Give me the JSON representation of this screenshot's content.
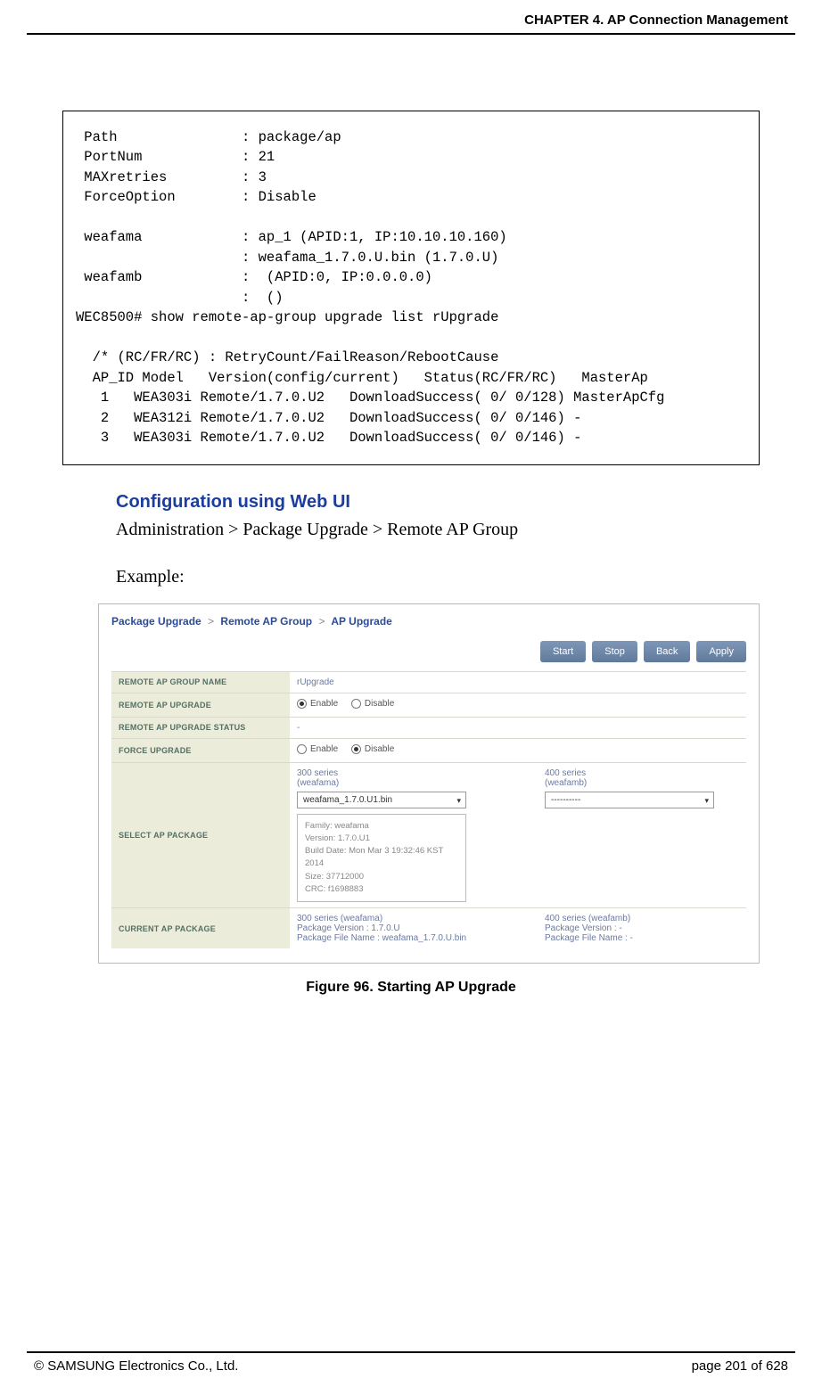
{
  "header": {
    "chapter": "CHAPTER 4. AP Connection Management"
  },
  "code_block": " Path               : package/ap\n PortNum            : 21\n MAXretries         : 3\n ForceOption        : Disable\n\n weafama            : ap_1 (APID:1, IP:10.10.10.160)\n                    : weafama_1.7.0.U.bin (1.7.0.U)\n weafamb            :  (APID:0, IP:0.0.0.0)\n                    :  ()\nWEC8500# show remote-ap-group upgrade list rUpgrade\n\n  /* (RC/FR/RC) : RetryCount/FailReason/RebootCause\n  AP_ID Model   Version(config/current)   Status(RC/FR/RC)   MasterAp\n   1   WEA303i Remote/1.7.0.U2   DownloadSuccess( 0/ 0/128) MasterApCfg\n   2   WEA312i Remote/1.7.0.U2   DownloadSuccess( 0/ 0/146) -\n   3   WEA303i Remote/1.7.0.U2   DownloadSuccess( 0/ 0/146) -",
  "section": {
    "heading": "Configuration using Web UI",
    "path_text": "Administration > Package Upgrade > Remote AP Group",
    "example_label": "Example:"
  },
  "ui": {
    "breadcrumb": [
      "Package Upgrade",
      "Remote AP Group",
      "AP Upgrade"
    ],
    "buttons": {
      "start": "Start",
      "stop": "Stop",
      "back": "Back",
      "apply": "Apply"
    },
    "rows": {
      "group_name": {
        "label": "REMOTE AP GROUP NAME",
        "value": "rUpgrade"
      },
      "upgrade": {
        "label": "REMOTE AP UPGRADE",
        "enable": "Enable",
        "disable": "Disable",
        "selected": "enable"
      },
      "status": {
        "label": "REMOTE AP UPGRADE STATUS",
        "value": "-"
      },
      "force": {
        "label": "FORCE UPGRADE",
        "enable": "Enable",
        "disable": "Disable",
        "selected": "disable"
      },
      "select_pkg": {
        "label": "SELECT AP PACKAGE",
        "col300_label": "300 series\n(weafama)",
        "col400_label": "400 series\n(weafamb)",
        "col300_select": "weafama_1.7.0.U1.bin",
        "col400_select": "----------",
        "details": "Family: weafama\nVersion: 1.7.0.U1\nBuild Date: Mon Mar 3 19:32:46 KST 2014\nSize: 37712000\nCRC: f1698883"
      },
      "current_pkg": {
        "label": "CURRENT AP PACKAGE",
        "col300": "300 series (weafama)\nPackage Version : 1.7.0.U\nPackage File Name : weafama_1.7.0.U.bin",
        "col400": "400 series (weafamb)\nPackage Version : -\nPackage File Name : -"
      }
    }
  },
  "figure_caption": "Figure 96. Starting AP Upgrade",
  "footer": {
    "copyright": "© SAMSUNG Electronics Co., Ltd.",
    "page": "page 201 of 628"
  }
}
